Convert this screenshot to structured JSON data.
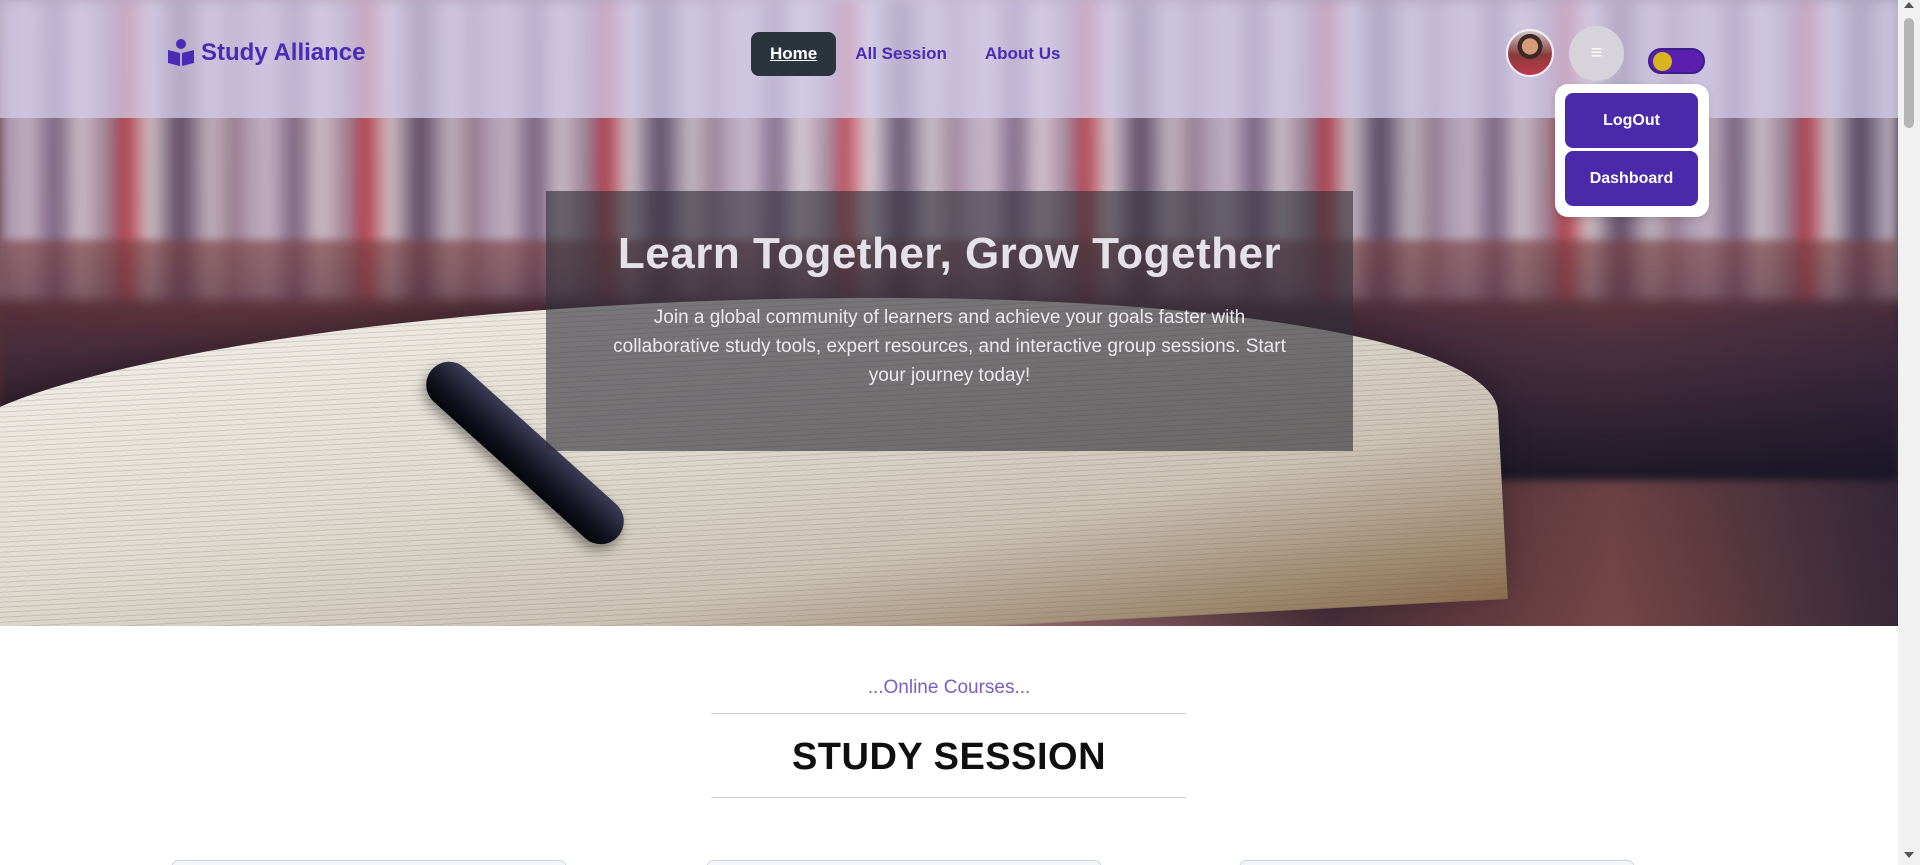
{
  "brand": {
    "name": "Study Alliance",
    "icon": "reader-icon",
    "color": "#4a2bb5"
  },
  "nav": {
    "links": [
      {
        "label": "Home",
        "active": true
      },
      {
        "label": "All Session",
        "active": false
      },
      {
        "label": "About Us",
        "active": false
      }
    ]
  },
  "user_menu": {
    "menu_icon": "≡",
    "items": [
      {
        "label": "LogOut"
      },
      {
        "label": "Dashboard"
      }
    ],
    "theme_toggle_on": true
  },
  "hero": {
    "title": "Learn Together, Grow Together",
    "subtitle": "Join a global community of learners and achieve your goals faster with collaborative study tools, expert resources, and interactive group sessions. Start your journey today!"
  },
  "section": {
    "eyebrow": "...Online Courses...",
    "title": "STUDY SESSION"
  },
  "colors": {
    "accent": "#4a2aab",
    "active_nav_bg": "#2b333d",
    "toggle_track": "#5b1fb0",
    "toggle_knob": "#d8b41f"
  }
}
